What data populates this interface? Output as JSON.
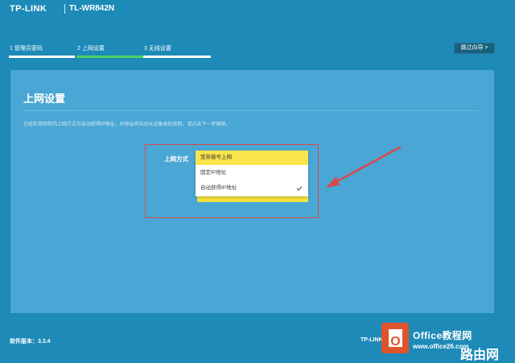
{
  "header": {
    "brand": "TP-LINK",
    "model": "TL-WR842N"
  },
  "steps": [
    {
      "label": "1 管理员密码",
      "active": false
    },
    {
      "label": "2 上网设置",
      "active": true
    },
    {
      "label": "3 无线设置",
      "active": false
    }
  ],
  "wizard": {
    "skip_label": "跳过向导 >"
  },
  "panel": {
    "title": "上网设置",
    "description": "已经检测到你的上网方式为自动获得IP地址，IP地址将自动从设备商处获取，请点击下一步继续。",
    "field_label": "上网方式"
  },
  "dropdown": {
    "options": [
      {
        "label": "宽带拨号上网",
        "selected": false,
        "highlighted": true
      },
      {
        "label": "固定IP地址",
        "selected": false,
        "highlighted": false
      },
      {
        "label": "自动获得IP地址",
        "selected": true,
        "highlighted": false
      }
    ]
  },
  "footer": {
    "version": "软件版本：3.3.4",
    "brand": "TP-LINK"
  },
  "watermark": {
    "logo_letter": "O",
    "title": "Office教程网",
    "site": "www.office26.com",
    "cn": "路由网"
  },
  "colors": {
    "background": "#1d8ab8",
    "panel": "#4aa6d4",
    "accent_active": "#4ad15e",
    "highlight_option": "#f9e44c",
    "annotation": "#d84a4a"
  }
}
